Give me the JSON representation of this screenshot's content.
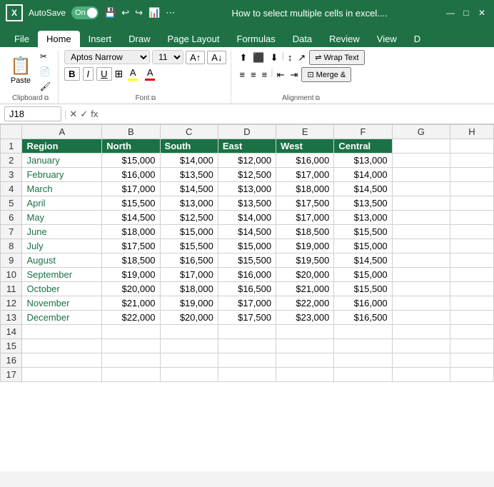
{
  "titlebar": {
    "app_icon": "X",
    "autosave": "AutoSave",
    "toggle_state": "On",
    "title": "How to select multiple cells in excel....",
    "close": "✕",
    "minimize": "—",
    "maximize": "□"
  },
  "toolbar_icons": [
    "⎌",
    "⎌",
    "↩",
    "↪",
    "📊",
    "⋯"
  ],
  "ribbon": {
    "tabs": [
      "File",
      "Home",
      "Insert",
      "Draw",
      "Page Layout",
      "Formulas",
      "Data",
      "Review",
      "View",
      "D"
    ],
    "active_tab": "Home",
    "groups": {
      "clipboard": {
        "label": "Clipboard",
        "paste_label": "Paste"
      },
      "font": {
        "label": "Font",
        "font_name": "Aptos Narrow",
        "font_size": "11",
        "bold": "B",
        "italic": "I",
        "underline": "U"
      },
      "alignment": {
        "label": "Alignment",
        "wrap_text": "Wrap Text",
        "merge": "Merge &"
      }
    }
  },
  "formula_bar": {
    "cell_ref": "J18",
    "formula": "fx"
  },
  "columns": {
    "headers": [
      "",
      "A",
      "B",
      "C",
      "D",
      "E",
      "F",
      "G",
      "H"
    ]
  },
  "table": {
    "headers": [
      "Region",
      "North",
      "South",
      "East",
      "West",
      "Central"
    ],
    "rows": [
      {
        "row_num": 1,
        "cells": [
          "Region",
          "North",
          "South",
          "East",
          "West",
          "Central"
        ]
      },
      {
        "row_num": 2,
        "cells": [
          "January",
          "$15,000",
          "$14,000",
          "$12,000",
          "$16,000",
          "$13,000"
        ]
      },
      {
        "row_num": 3,
        "cells": [
          "February",
          "$16,000",
          "$13,500",
          "$12,500",
          "$17,000",
          "$14,000"
        ]
      },
      {
        "row_num": 4,
        "cells": [
          "March",
          "$17,000",
          "$14,500",
          "$13,000",
          "$18,000",
          "$14,500"
        ]
      },
      {
        "row_num": 5,
        "cells": [
          "April",
          "$15,500",
          "$13,000",
          "$13,500",
          "$17,500",
          "$13,500"
        ]
      },
      {
        "row_num": 6,
        "cells": [
          "May",
          "$14,500",
          "$12,500",
          "$14,000",
          "$17,000",
          "$13,000"
        ]
      },
      {
        "row_num": 7,
        "cells": [
          "June",
          "$18,000",
          "$15,000",
          "$14,500",
          "$18,500",
          "$15,500"
        ]
      },
      {
        "row_num": 8,
        "cells": [
          "July",
          "$17,500",
          "$15,500",
          "$15,000",
          "$19,000",
          "$15,000"
        ]
      },
      {
        "row_num": 9,
        "cells": [
          "August",
          "$18,500",
          "$16,500",
          "$15,500",
          "$19,500",
          "$14,500"
        ]
      },
      {
        "row_num": 10,
        "cells": [
          "September",
          "$19,000",
          "$17,000",
          "$16,000",
          "$20,000",
          "$15,000"
        ]
      },
      {
        "row_num": 11,
        "cells": [
          "October",
          "$20,000",
          "$18,000",
          "$16,500",
          "$21,000",
          "$15,500"
        ]
      },
      {
        "row_num": 12,
        "cells": [
          "November",
          "$21,000",
          "$19,000",
          "$17,000",
          "$22,000",
          "$16,000"
        ]
      },
      {
        "row_num": 13,
        "cells": [
          "December",
          "$22,000",
          "$20,000",
          "$17,500",
          "$23,000",
          "$16,500"
        ]
      },
      {
        "row_num": 14,
        "cells": [
          "",
          "",
          "",
          "",
          "",
          ""
        ]
      },
      {
        "row_num": 15,
        "cells": [
          "",
          "",
          "",
          "",
          "",
          ""
        ]
      },
      {
        "row_num": 16,
        "cells": [
          "",
          "",
          "",
          "",
          "",
          ""
        ]
      },
      {
        "row_num": 17,
        "cells": [
          "",
          "",
          "",
          "",
          "",
          ""
        ]
      }
    ]
  },
  "colors": {
    "excel_green": "#1f7145",
    "header_bg": "#1a7145",
    "header_text": "#ffffff",
    "region_text": "#1a7145"
  }
}
